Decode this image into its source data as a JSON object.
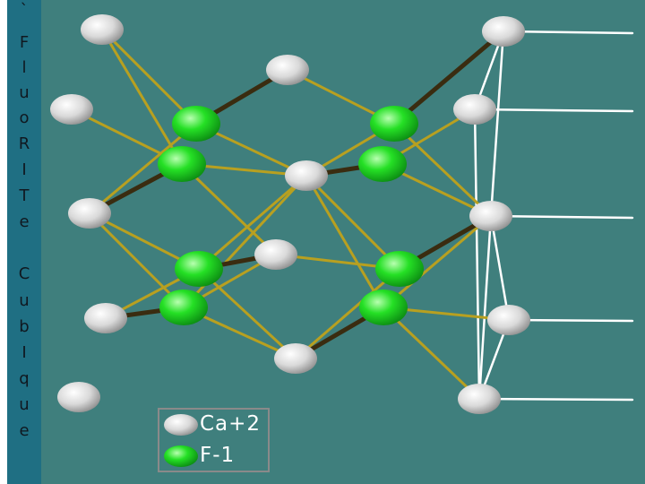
{
  "title_strip": {
    "chars": [
      "`",
      "F",
      "l",
      "u",
      "o",
      "R",
      "I",
      "T",
      "e",
      "",
      "C",
      "u",
      "b",
      "I",
      "q",
      "u",
      "e"
    ]
  },
  "legend": {
    "ca_label": "Ca+2",
    "f_label": "F-1"
  },
  "colors": {
    "background": "#3f7f7d",
    "title_strip": "#1f6f83",
    "ca_atom": "#e6e6e6",
    "f_atom": "#22dd22",
    "bond_ca_f": "#b8a020",
    "bond_f_f": "#3a2c10",
    "cell_edge": "#ffffff"
  }
}
